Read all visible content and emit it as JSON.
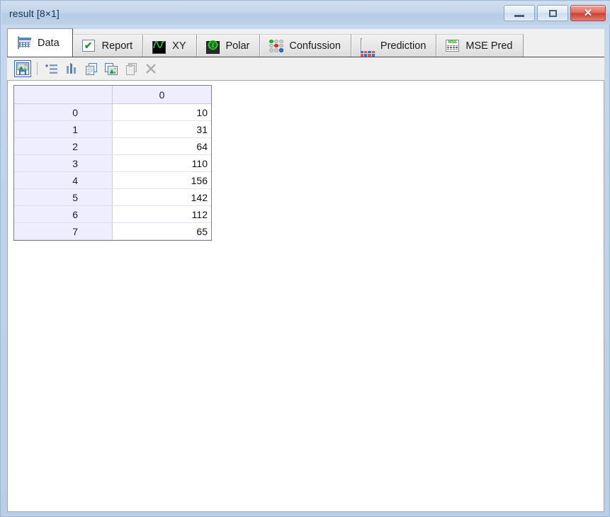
{
  "window": {
    "title": "result [8×1]",
    "controls": {
      "minimize": "minimize-button",
      "maximize": "maximize-button",
      "close_glyph": "✕"
    }
  },
  "tabs": [
    {
      "label": "Data",
      "icon": "table-grid-icon",
      "active": true
    },
    {
      "label": "Report",
      "icon": "checkmark-box-icon",
      "active": false
    },
    {
      "label": "XY",
      "icon": "sine-wave-icon",
      "active": false
    },
    {
      "label": "Polar",
      "icon": "polar-plot-icon",
      "active": false
    },
    {
      "label": "Confussion",
      "icon": "confusion-matrix-icon",
      "active": false
    },
    {
      "label": "Prediction",
      "icon": "prediction-grid-icon",
      "active": false
    },
    {
      "label": "MSE Pred",
      "icon": "mse-grid-icon",
      "active": false
    }
  ],
  "toolbar": {
    "buttons": [
      {
        "name": "save-image-button",
        "icon": "save-image-icon",
        "enabled": true,
        "selected": true
      },
      {
        "name": "insert-rows-button",
        "icon": "rows-list-icon",
        "enabled": true,
        "selected": false
      },
      {
        "name": "insert-columns-button",
        "icon": "columns-chart-icon",
        "enabled": true,
        "selected": false
      },
      {
        "name": "copy-button",
        "icon": "copy-document-icon",
        "enabled": true,
        "selected": false
      },
      {
        "name": "paste-image-button",
        "icon": "paste-image-icon",
        "enabled": true,
        "selected": false
      },
      {
        "name": "clipboard-button",
        "icon": "clipboard-icon",
        "enabled": false,
        "selected": false
      },
      {
        "name": "delete-button",
        "icon": "close-x-icon",
        "enabled": false,
        "selected": false
      }
    ]
  },
  "grid": {
    "corner_label": "",
    "columns": [
      "0"
    ],
    "row_headers": [
      "0",
      "1",
      "2",
      "3",
      "4",
      "5",
      "6",
      "7"
    ],
    "rows": [
      [
        "10"
      ],
      [
        "31"
      ],
      [
        "64"
      ],
      [
        "110"
      ],
      [
        "156"
      ],
      [
        "142"
      ],
      [
        "112"
      ],
      [
        "65"
      ]
    ]
  },
  "colors": {
    "title_bar": "#c3d6ea",
    "frame": "#b9cfe7",
    "header_cell": "#eeeeff",
    "header_text": "#181848",
    "accent_selected": "#3a66a8",
    "close_button": "#cc3f33"
  }
}
